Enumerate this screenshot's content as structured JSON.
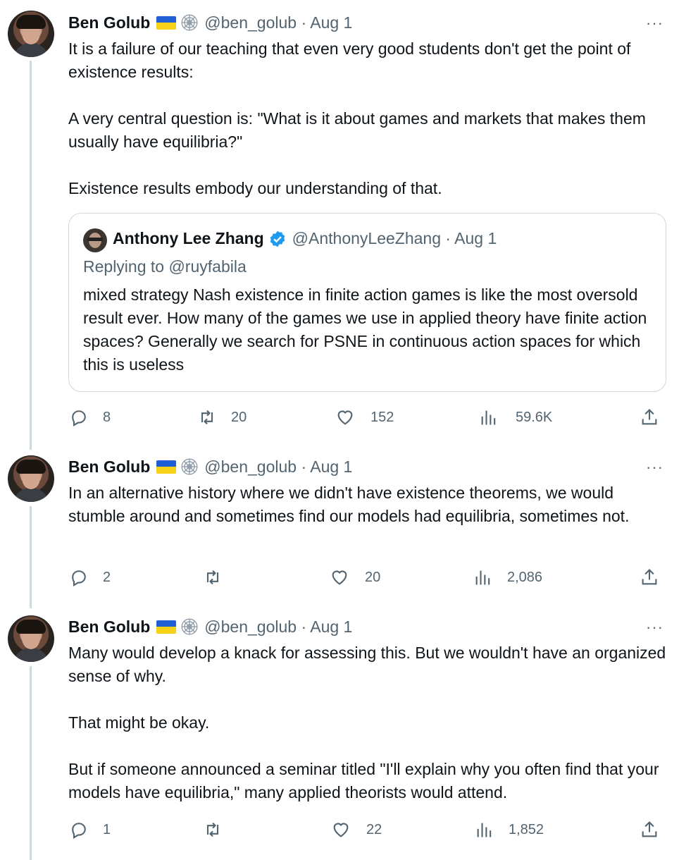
{
  "tweets": [
    {
      "author_name": "Ben Golub",
      "handle_date": "@ben_golub · Aug 1",
      "more": "···",
      "paragraphs": [
        "It is a failure of our teaching that even very good students don't get the point of existence results:",
        "A very central question is: \"What is it about games and markets that makes them usually have equilibria?\"",
        "Existence results embody our understanding of that."
      ],
      "quote": {
        "author_name": "Anthony Lee Zhang",
        "handle_date": "@AnthonyLeeZhang · Aug 1",
        "replying_to": "Replying to @ruyfabila",
        "text": "mixed strategy Nash existence in finite action games is like the most oversold result ever. How many of the games we use in applied theory have finite action spaces? Generally we search for PSNE in continuous action spaces for which this is useless"
      },
      "stats": {
        "replies": "8",
        "retweets": "20",
        "likes": "152",
        "views": "59.6K"
      }
    },
    {
      "author_name": "Ben Golub",
      "handle_date": "@ben_golub · Aug 1",
      "more": "···",
      "paragraphs": [
        "In an alternative history where we didn't have existence theorems, we would stumble around and sometimes find our models had equilibria, sometimes not."
      ],
      "stats": {
        "replies": "2",
        "retweets": "",
        "likes": "20",
        "views": "2,086"
      }
    },
    {
      "author_name": "Ben Golub",
      "handle_date": "@ben_golub · Aug 1",
      "more": "···",
      "paragraphs": [
        "Many would develop a knack for assessing this. But we wouldn't have an organized sense of why.",
        "That might be okay.",
        "But if someone announced a seminar titled \"I'll explain why you often find that your models have equilibria,\" many applied theorists would attend."
      ],
      "stats": {
        "replies": "1",
        "retweets": "",
        "likes": "22",
        "views": "1,852"
      }
    }
  ],
  "icons": {
    "flag": "ukraine-flag-icon",
    "web": "spiderweb-icon",
    "verified": "verified-badge-icon",
    "reply": "reply-icon",
    "retweet": "retweet-icon",
    "like": "heart-icon",
    "views": "views-icon",
    "share": "share-icon"
  },
  "colors": {
    "text": "#0f1419",
    "secondary": "#536471",
    "border": "#cfd9de",
    "verified": "#1d9bf0"
  }
}
